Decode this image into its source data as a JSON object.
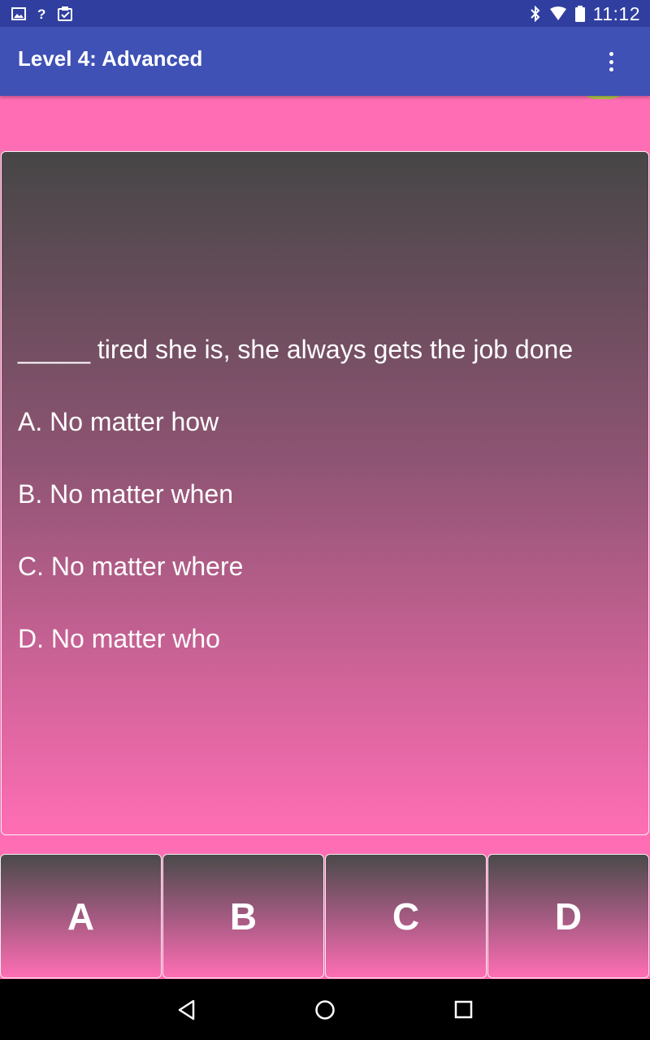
{
  "status_bar": {
    "time": "11:12",
    "left_icons": [
      "image-icon",
      "question-icon",
      "clipboard-check-icon"
    ],
    "right_icons": [
      "bluetooth-icon",
      "wifi-icon",
      "battery-icon"
    ],
    "help_glyph": "?"
  },
  "app_bar": {
    "title": "Level 4: Advanced",
    "menu_icon": "overflow-menu-icon"
  },
  "question": {
    "text": "_____ tired she is, she always gets the job done",
    "options": [
      "A. No matter how",
      "B. No matter when",
      "C. No matter where",
      "D. No matter who"
    ]
  },
  "answers": [
    "A",
    "B",
    "C",
    "D"
  ],
  "nav_bar": {
    "icons": [
      "back-icon",
      "home-icon",
      "recents-icon"
    ]
  },
  "colors": {
    "status_bar": "#303f9f",
    "app_bar": "#3f51b5",
    "background": "#ff6eb4",
    "gradient_top": "#464646"
  }
}
